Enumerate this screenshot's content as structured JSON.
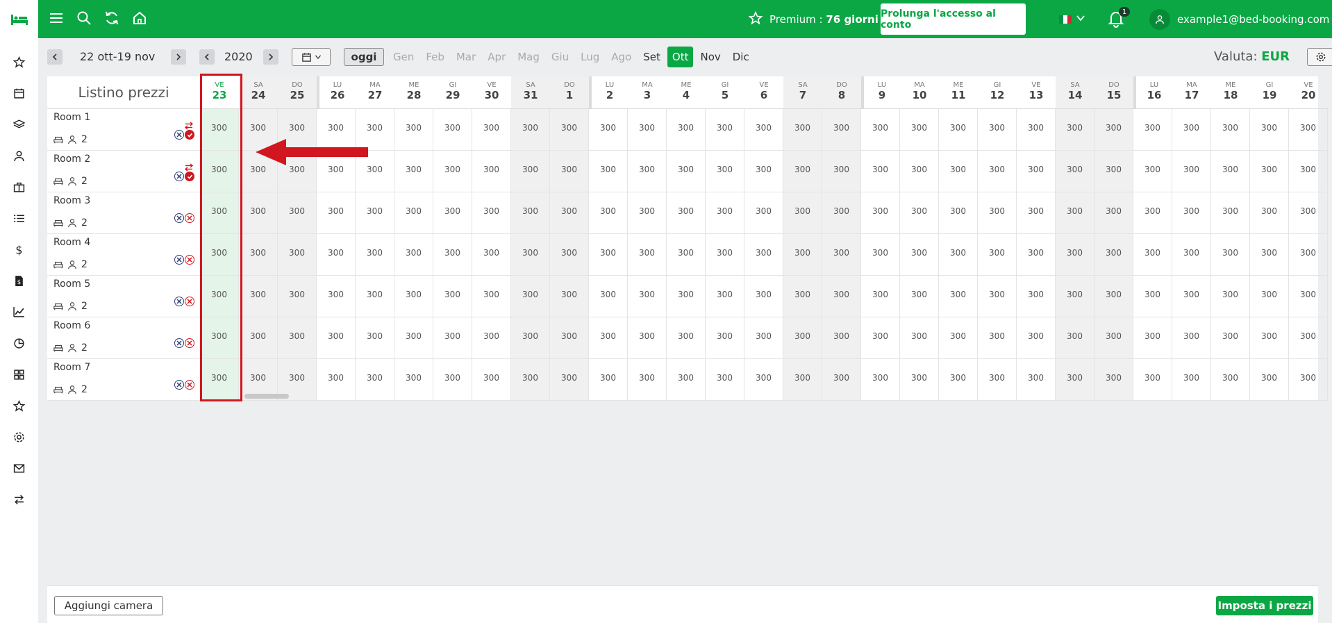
{
  "colors": {
    "brand": "#0ba745",
    "highlight": "#d1161f",
    "today_bg": "#e5f4e9"
  },
  "topbar": {
    "premium_label": "Premium : ",
    "premium_days": "76 giorni",
    "extend_button": "Prolunga l'accesso al conto",
    "notifications_count": "1",
    "user_email": "example1@bed-booking.com"
  },
  "toolbar": {
    "range_label": "22 ott-19 nov",
    "year": "2020",
    "today_button": "oggi",
    "months": [
      "Gen",
      "Feb",
      "Mar",
      "Apr",
      "Mag",
      "Giu",
      "Lug",
      "Ago",
      "Set",
      "Ott",
      "Nov",
      "Dic"
    ],
    "active_month": "Ott",
    "currency_label": "Valuta: ",
    "currency": "EUR"
  },
  "grid": {
    "title": "Listino prezzi",
    "days": [
      {
        "wd": "VE",
        "d": "23"
      },
      {
        "wd": "SA",
        "d": "24"
      },
      {
        "wd": "DO",
        "d": "25"
      },
      {
        "wd": "LU",
        "d": "26"
      },
      {
        "wd": "MA",
        "d": "27"
      },
      {
        "wd": "ME",
        "d": "28"
      },
      {
        "wd": "GI",
        "d": "29"
      },
      {
        "wd": "VE",
        "d": "30"
      },
      {
        "wd": "SA",
        "d": "31"
      },
      {
        "wd": "DO",
        "d": "1"
      },
      {
        "wd": "LU",
        "d": "2"
      },
      {
        "wd": "MA",
        "d": "3"
      },
      {
        "wd": "ME",
        "d": "4"
      },
      {
        "wd": "GI",
        "d": "5"
      },
      {
        "wd": "VE",
        "d": "6"
      },
      {
        "wd": "SA",
        "d": "7"
      },
      {
        "wd": "DO",
        "d": "8"
      },
      {
        "wd": "LU",
        "d": "9"
      },
      {
        "wd": "MA",
        "d": "10"
      },
      {
        "wd": "ME",
        "d": "11"
      },
      {
        "wd": "GI",
        "d": "12"
      },
      {
        "wd": "VE",
        "d": "13"
      },
      {
        "wd": "SA",
        "d": "14"
      },
      {
        "wd": "DO",
        "d": "15"
      },
      {
        "wd": "LU",
        "d": "16"
      },
      {
        "wd": "MA",
        "d": "17"
      },
      {
        "wd": "ME",
        "d": "18"
      },
      {
        "wd": "GI",
        "d": "19"
      },
      {
        "wd": "VE",
        "d": "20"
      }
    ],
    "rooms": [
      {
        "name": "Room 1",
        "guests": "2",
        "sync": true
      },
      {
        "name": "Room 2",
        "guests": "2",
        "sync": true
      },
      {
        "name": "Room 3",
        "guests": "2",
        "sync": false
      },
      {
        "name": "Room 4",
        "guests": "2",
        "sync": false
      },
      {
        "name": "Room 5",
        "guests": "2",
        "sync": false
      },
      {
        "name": "Room 6",
        "guests": "2",
        "sync": false
      },
      {
        "name": "Room 7",
        "guests": "2",
        "sync": false
      }
    ],
    "price": "300"
  },
  "footer": {
    "add_room": "Aggiungi camera",
    "set_prices": "Imposta i prezzi"
  }
}
